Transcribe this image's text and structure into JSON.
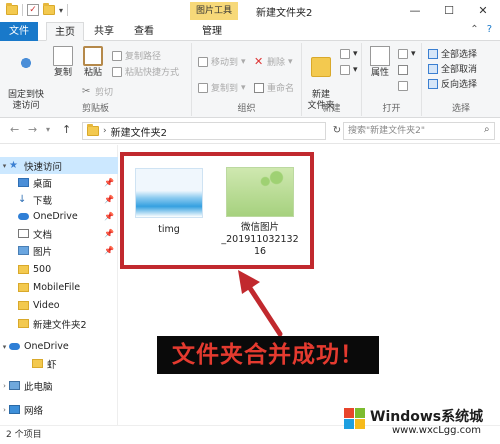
{
  "window": {
    "title": "新建文件夹2",
    "context_tab": "图片工具",
    "min": "—",
    "max": "☐",
    "close": "✕"
  },
  "tabs": [
    "文件",
    "主页",
    "共享",
    "查看",
    "管理"
  ],
  "ribbon": {
    "clipboard": {
      "label": "剪贴板",
      "pin": "固定到快\n速访问",
      "copy": "复制",
      "paste": "粘贴",
      "copy_path": "复制路径",
      "paste_shortcut": "粘贴快捷方式",
      "cut": "剪切"
    },
    "organize": {
      "label": "组织",
      "move_to": "移动到",
      "delete": "删除",
      "copy_to": "复制到",
      "rename": "重命名"
    },
    "new": {
      "label": "新建",
      "new_folder": "新建\n文件夹"
    },
    "open": {
      "label": "打开",
      "properties": "属性"
    },
    "select": {
      "label": "选择",
      "select_all": "全部选择",
      "select_none": "全部取消",
      "invert": "反向选择"
    }
  },
  "address": {
    "path": "新建文件夹2",
    "search_placeholder": "搜索\"新建文件夹2\""
  },
  "nav": {
    "quick_access": "快速访问",
    "items": [
      "桌面",
      "下载",
      "OneDrive",
      "文档",
      "图片",
      "500",
      "MobileFile",
      "Video",
      "新建文件夹2"
    ],
    "onedrive": "OneDrive",
    "onedrive_child": "虾",
    "this_pc": "此电脑",
    "network": "网络"
  },
  "files": [
    {
      "name": "timg"
    },
    {
      "name": "微信图片\n_201911032132\n16"
    }
  ],
  "annotation": {
    "text": "文件夹合并成功！"
  },
  "status": {
    "count": "2 个项目"
  },
  "watermark": {
    "brand": "Windows系统城",
    "url": "www.wxcLgg.com"
  },
  "colors": {
    "accent": "#1979ca",
    "frame": "#c1292e",
    "callout_text": "#e43a2f"
  }
}
